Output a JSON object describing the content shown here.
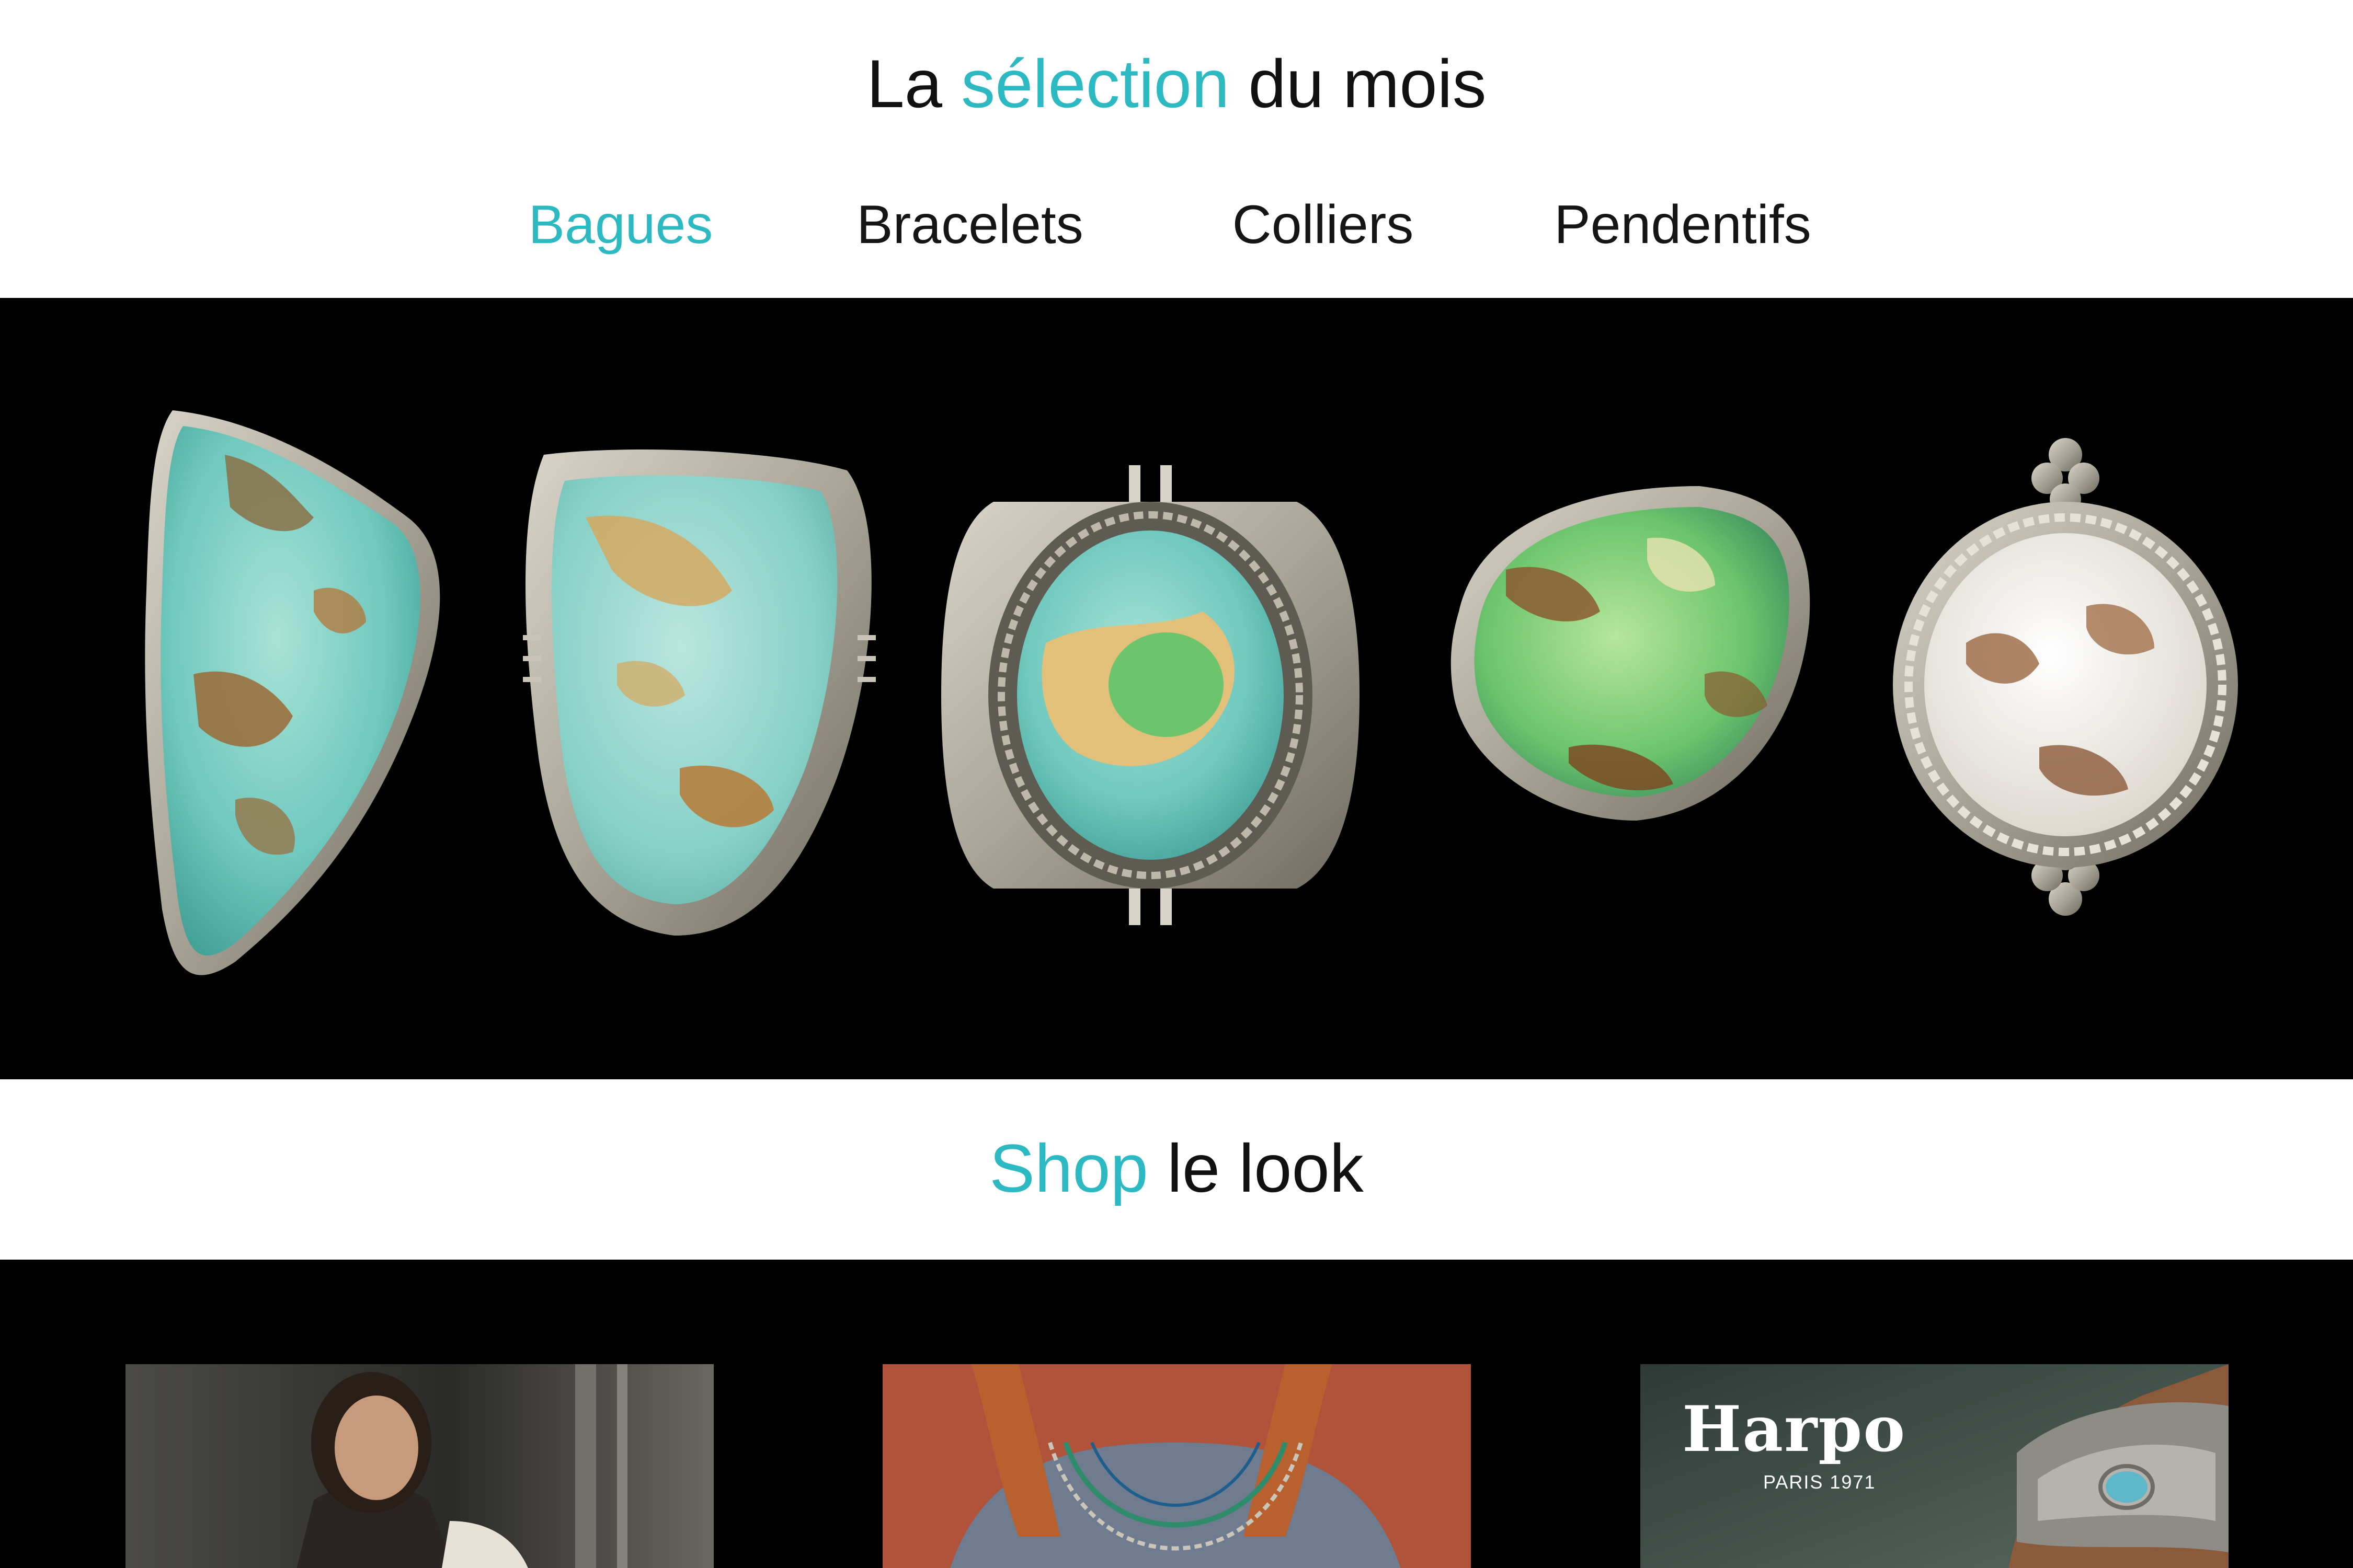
{
  "header": {
    "title_part1": "La",
    "title_accent": "sélection",
    "title_part2": "du mois",
    "tabs": [
      {
        "label": "Bagues",
        "active": true
      },
      {
        "label": "Bracelets",
        "active": false
      },
      {
        "label": "Colliers",
        "active": false
      },
      {
        "label": "Pendentifs",
        "active": false
      }
    ]
  },
  "carousel": {
    "items": [
      {
        "icon": "turquoise-ring-freeform"
      },
      {
        "icon": "turquoise-ring-teardrop"
      },
      {
        "icon": "turquoise-ring-oval"
      },
      {
        "icon": "turquoise-ring-green"
      },
      {
        "icon": "white-buffalo-ring"
      }
    ]
  },
  "shop": {
    "title_accent": "Shop",
    "title_rest": "le look"
  },
  "look": {
    "cards": [
      {
        "icon": "model-photo"
      },
      {
        "icon": "necklace-photo"
      },
      {
        "icon": "harpo-cuff-photo",
        "logo": "Harpo",
        "logo_sub": "PARIS 1971"
      }
    ]
  },
  "colors": {
    "accent": "#2cb9c1",
    "text": "#111111",
    "band_background": "#000000"
  }
}
